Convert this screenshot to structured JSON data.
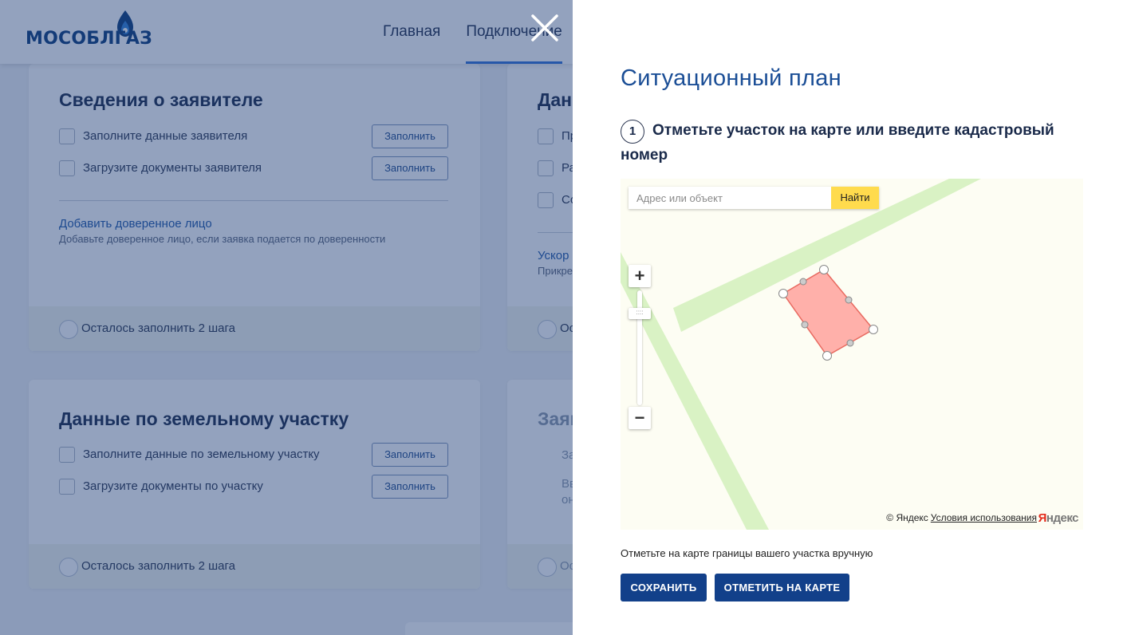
{
  "header": {
    "logo_text": "МОСОБЛГАЗ",
    "nav": [
      {
        "label": "Главная"
      },
      {
        "label": "Подключение"
      }
    ]
  },
  "cards": {
    "applicant": {
      "title": "Сведения о заявителе",
      "rows": [
        {
          "label": "Заполните данные заявителя",
          "button": "Заполнить"
        },
        {
          "label": "Загрузите документы заявителя",
          "button": "Заполнить"
        }
      ],
      "trust_link": "Добавить доверенное лицо",
      "trust_hint": "Добавьте доверенное лицо, если заявка подается по доверенности",
      "footer": "Осталось заполнить 2 шага"
    },
    "land": {
      "title": "Данные по земельному участку",
      "rows": [
        {
          "label": "Заполните данные по земельному участку",
          "button": "Заполнить"
        },
        {
          "label": "Загрузите документы по участку",
          "button": "Заполнить"
        }
      ],
      "footer": "Осталось заполнить 2 шага"
    },
    "right_top": {
      "title_fragment": "Дан",
      "row_fragments": [
        "Пр",
        "Ра",
        "Со"
      ],
      "link_fragment": "Ускор",
      "hint_fragment": "Прикре",
      "footer_fragment": "Ос"
    },
    "right_bottom": {
      "title_fragment": "Заяв",
      "row_fragments": [
        "За",
        "Вв",
        "он"
      ],
      "footer_fragment": "Ос"
    }
  },
  "drawer": {
    "title": "Ситуационный план",
    "step_number": "1",
    "step_text": "Отметьте участок на карте или введите кадастровый номер",
    "map": {
      "search_placeholder": "Адрес или объект",
      "search_button": "Найти",
      "zoom_in": "+",
      "zoom_out": "−",
      "zoom_handle": "::::",
      "copyright": "© Яндекс",
      "terms": "Условия использования",
      "brand_first": "Я",
      "brand_rest": "ндекс",
      "colors": {
        "background": "#fdfdf3",
        "road": "#d9f2c4",
        "polygon_fill": "#ffb0aa",
        "polygon_stroke": "#e86a60"
      }
    },
    "hint": "Отметьте на карте границы вашего участка вручную",
    "buttons": {
      "save": "СОХРАНИТЬ",
      "mark": "ОТМЕТИТЬ НА КАРТЕ"
    }
  },
  "colors": {
    "brand": "#0b3a7a",
    "primary_button": "#12408a",
    "overlay": "rgba(30,60,120,0.48)"
  }
}
